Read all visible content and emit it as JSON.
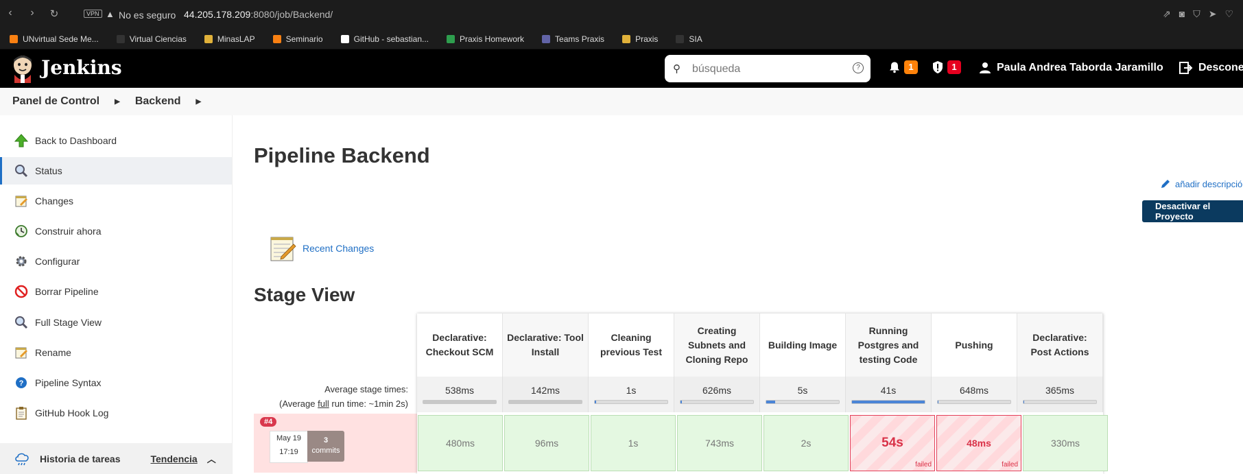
{
  "browser": {
    "vpn": "VPN",
    "insecure_label": "No es seguro",
    "url_host": "44.205.178.209",
    "url_path": ":8080/job/Backend/"
  },
  "bookmarks": [
    {
      "label": "UNvirtual Sede Me...",
      "icon": "moodle-icon",
      "color": "#f98012"
    },
    {
      "label": "Virtual Ciencias",
      "icon": "bookmark-icon",
      "color": "#333"
    },
    {
      "label": "MinasLAP",
      "icon": "gear-icon",
      "color": "#e0b13a"
    },
    {
      "label": "Seminario",
      "icon": "moodle-icon",
      "color": "#f98012"
    },
    {
      "label": "GitHub - sebastian...",
      "icon": "github-icon",
      "color": "#fff"
    },
    {
      "label": "Praxis Homework",
      "icon": "classroom-icon",
      "color": "#2e9e4e"
    },
    {
      "label": "Teams Praxis",
      "icon": "teams-icon",
      "color": "#6264a7"
    },
    {
      "label": "Praxis",
      "icon": "praxis-icon",
      "color": "#e0b13a"
    },
    {
      "label": "SIA",
      "icon": "bookmark-icon",
      "color": "#333"
    }
  ],
  "header": {
    "brand": "Jenkins",
    "search_placeholder": "búsqueda",
    "notifications_count": "1",
    "security_count": "1",
    "user_name": "Paula Andrea Taborda Jaramillo",
    "logout_label": "Desconectar"
  },
  "breadcrumb": [
    "Panel de Control",
    "Backend"
  ],
  "sidebar": {
    "items": [
      {
        "label": "Back to Dashboard",
        "icon": "up-arrow-icon"
      },
      {
        "label": "Status",
        "icon": "search-icon"
      },
      {
        "label": "Changes",
        "icon": "notepad-icon"
      },
      {
        "label": "Construir ahora",
        "icon": "build-clock-icon"
      },
      {
        "label": "Configurar",
        "icon": "gear-icon"
      },
      {
        "label": "Borrar Pipeline",
        "icon": "no-entry-icon"
      },
      {
        "label": "Full Stage View",
        "icon": "search-icon"
      },
      {
        "label": "Rename",
        "icon": "notepad-icon"
      },
      {
        "label": "Pipeline Syntax",
        "icon": "help-icon"
      },
      {
        "label": "GitHub Hook Log",
        "icon": "clipboard-icon"
      }
    ],
    "history_label": "Historia de tareas",
    "trend_label": "Tendencia"
  },
  "main": {
    "title": "Pipeline Backend",
    "add_description": "añadir descripción",
    "disable_button": "Desactivar el Proyecto",
    "recent_changes": "Recent Changes",
    "stage_view_title": "Stage View",
    "avg_stage_times": "Average stage times:",
    "avg_full_prefix": "(Average ",
    "avg_full_word": "full",
    "avg_full_suffix": " run time: ~1min 2s)"
  },
  "stages": [
    {
      "name": "Declarative: Checkout SCM",
      "avg": "538ms",
      "avg_fraction": 1.0,
      "run": "480ms",
      "failed": false
    },
    {
      "name": "Declarative: Tool Install",
      "avg": "142ms",
      "avg_fraction": 1.0,
      "run": "96ms",
      "failed": false
    },
    {
      "name": "Cleaning previous Test",
      "avg": "1s",
      "avg_fraction": 0.02,
      "run": "1s",
      "failed": false
    },
    {
      "name": "Creating Subnets and Cloning Repo",
      "avg": "626ms",
      "avg_fraction": 0.02,
      "run": "743ms",
      "failed": false
    },
    {
      "name": "Building Image",
      "avg": "5s",
      "avg_fraction": 0.12,
      "run": "2s",
      "failed": false
    },
    {
      "name": "Running Postgres and testing Code",
      "avg": "41s",
      "avg_fraction": 1.0,
      "run": "54s",
      "failed": true
    },
    {
      "name": "Pushing",
      "avg": "648ms",
      "avg_fraction": 0.01,
      "run": "48ms",
      "failed": true
    },
    {
      "name": "Declarative: Post Actions",
      "avg": "365ms",
      "avg_fraction": 0.01,
      "run": "330ms",
      "failed": false
    }
  ],
  "build": {
    "number": "#4",
    "date": "May 19",
    "time": "17:19",
    "commits_count": "3",
    "commits_label": "commits",
    "failed_label": "failed"
  }
}
